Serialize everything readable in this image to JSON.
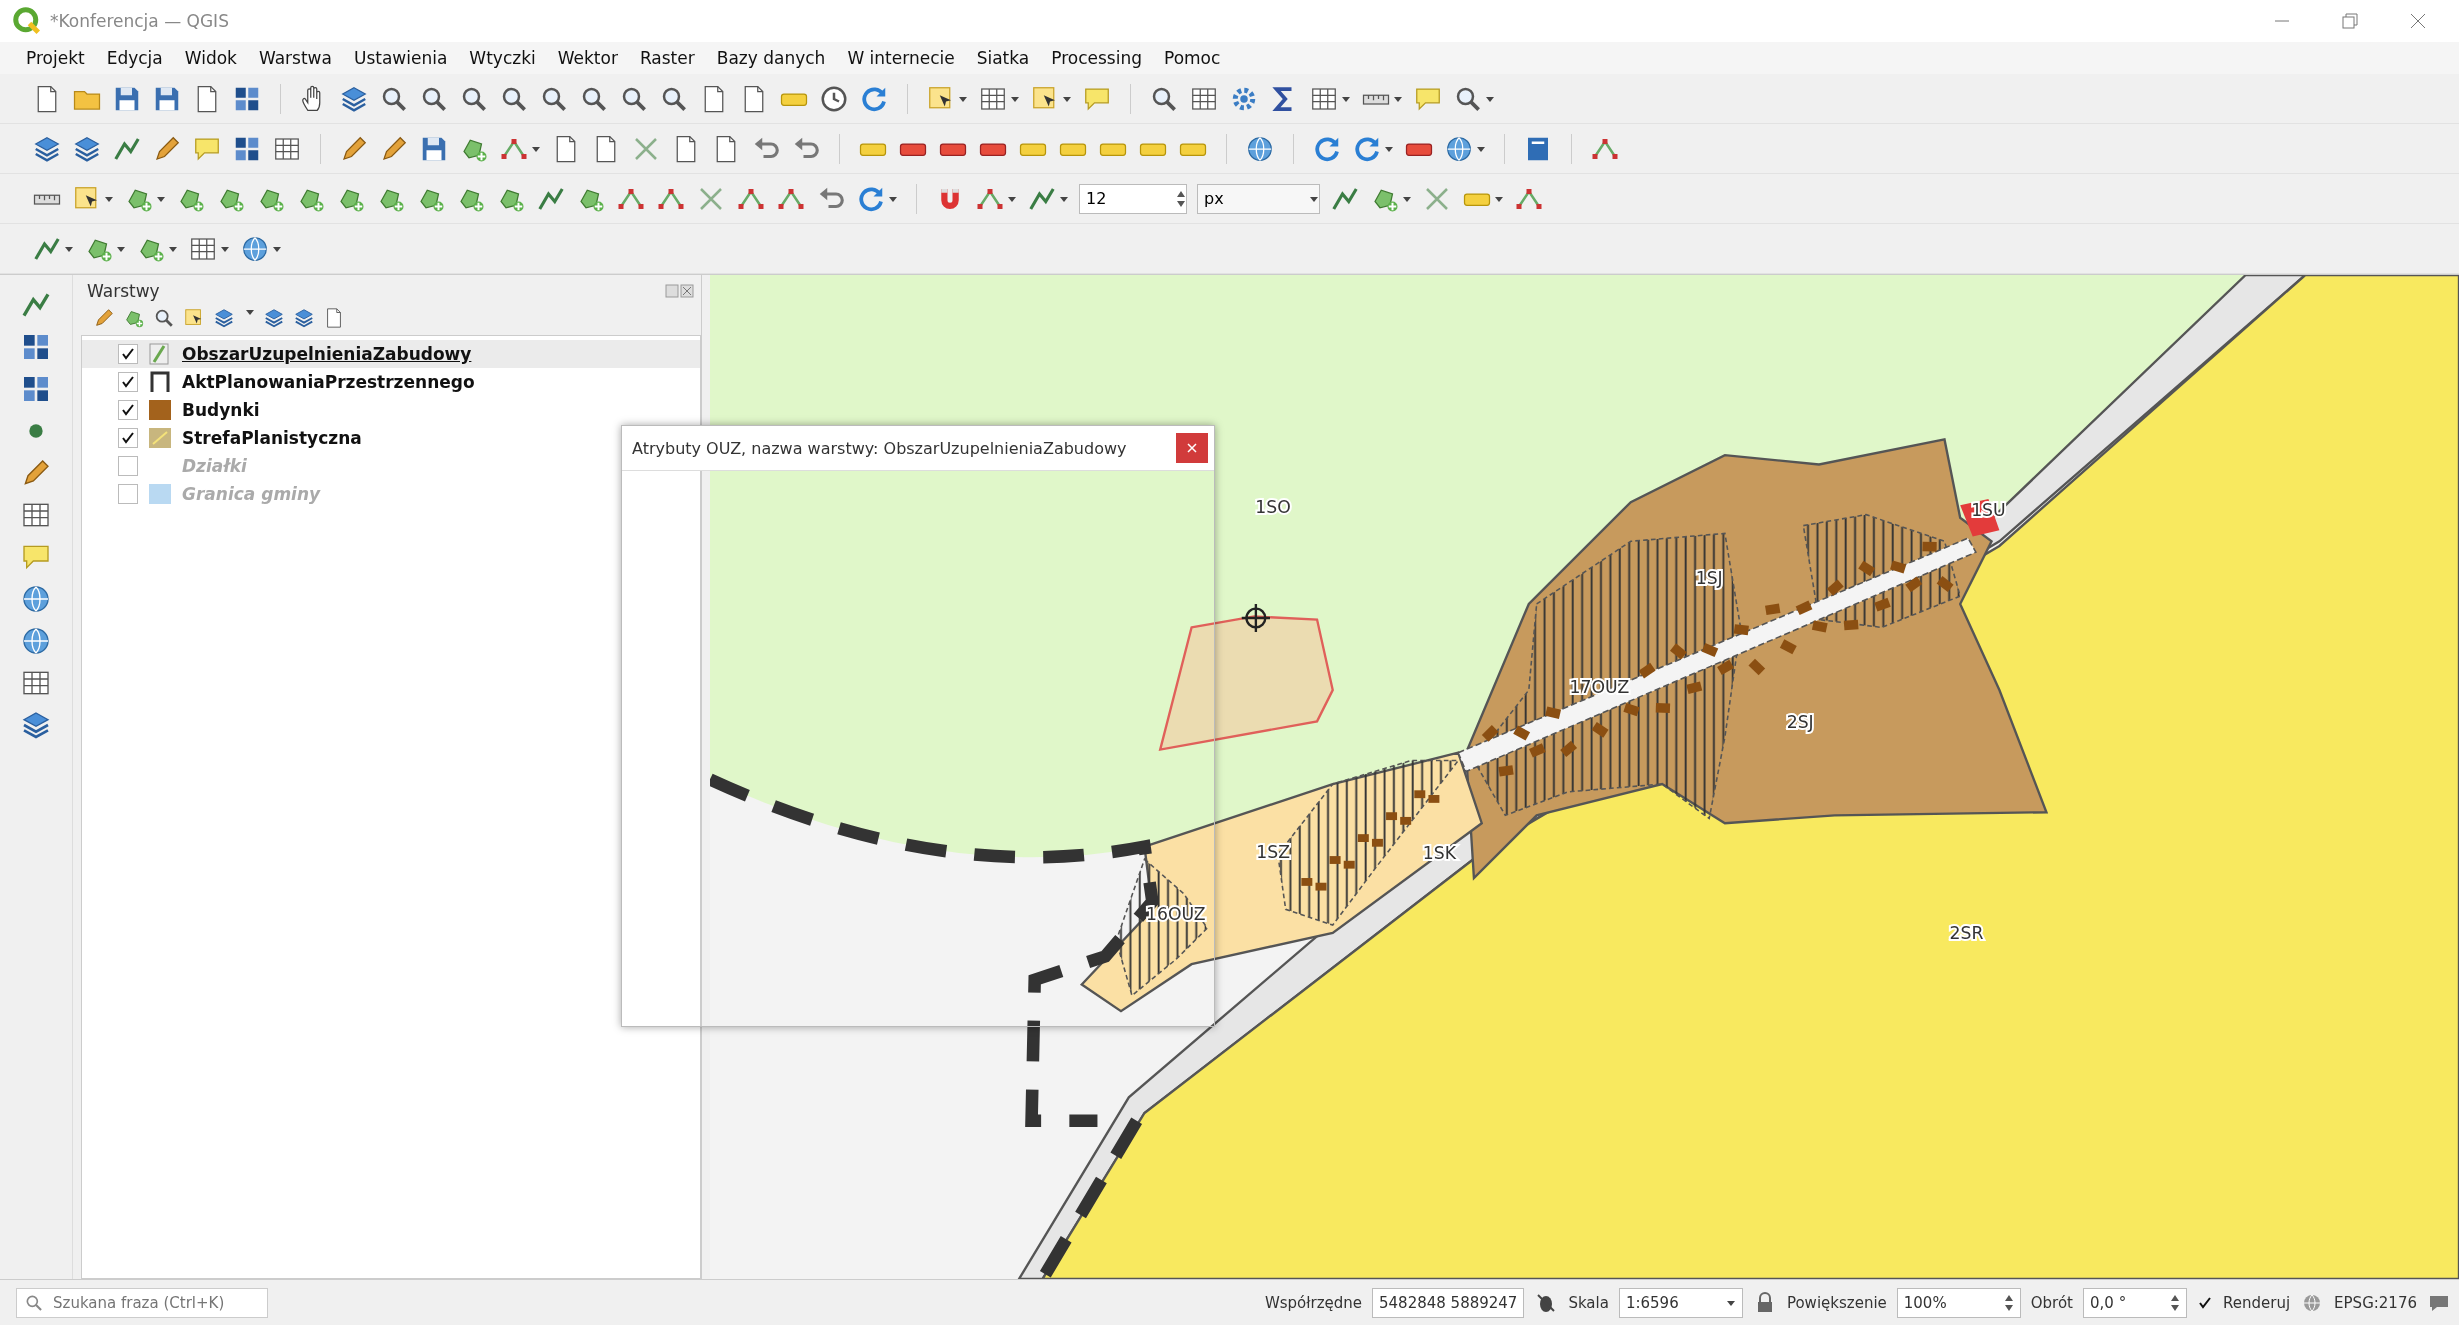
{
  "window": {
    "title": "*Konferencja — QGIS"
  },
  "menu": [
    "Projekt",
    "Edycja",
    "Widok",
    "Warstwa",
    "Ustawienia",
    "Wtyczki",
    "Wektor",
    "Raster",
    "Bazy danych",
    "W internecie",
    "Siatka",
    "Processing",
    "Pomoc"
  ],
  "snapping_toolbar": {
    "tolerance": "12",
    "units": "px"
  },
  "layers_panel": {
    "title": "Warstwy",
    "layers": [
      {
        "name": "ObszarUzupelnieniaZabudowy",
        "checked": true,
        "selected": true,
        "kind": "line",
        "color": "#6aa84f"
      },
      {
        "name": "AktPlanowaniaPrzestrzennego",
        "checked": true,
        "selected": false,
        "kind": "outline",
        "color": "#333333"
      },
      {
        "name": "Budynki",
        "checked": true,
        "selected": false,
        "kind": "fill",
        "color": "#a3621c"
      },
      {
        "name": "StrefaPlanistyczna",
        "checked": true,
        "selected": false,
        "kind": "pattern",
        "color": "#c8b67e"
      },
      {
        "name": "Działki",
        "checked": false,
        "selected": false,
        "kind": "none"
      },
      {
        "name": "Granica gminy",
        "checked": false,
        "selected": false,
        "kind": "fill",
        "color": "#b9d9f2"
      }
    ]
  },
  "dialog": {
    "title": "Atrybuty OUZ, nazwa warstwy: ObszarUzupelnieniaZabudowy"
  },
  "map": {
    "labels": [
      "1SO",
      "1SU",
      "1SJ",
      "17OUZ",
      "2SJ",
      "1SZ",
      "1SK",
      "16OUZ",
      "2SR"
    ]
  },
  "status_bar": {
    "search_placeholder": "Szukana fraza (Ctrl+K)",
    "coordinates_label": "Współrzędne",
    "coordinates": "5482848 5889247",
    "scale_label": "Skala",
    "scale": "1:6596",
    "magnifier_label": "Powiększenie",
    "magnifier": "100%",
    "rotation_label": "Obrót",
    "rotation": "0,0 °",
    "render": {
      "label": "Renderuj",
      "checked": true
    },
    "crs": "EPSG:2176"
  }
}
